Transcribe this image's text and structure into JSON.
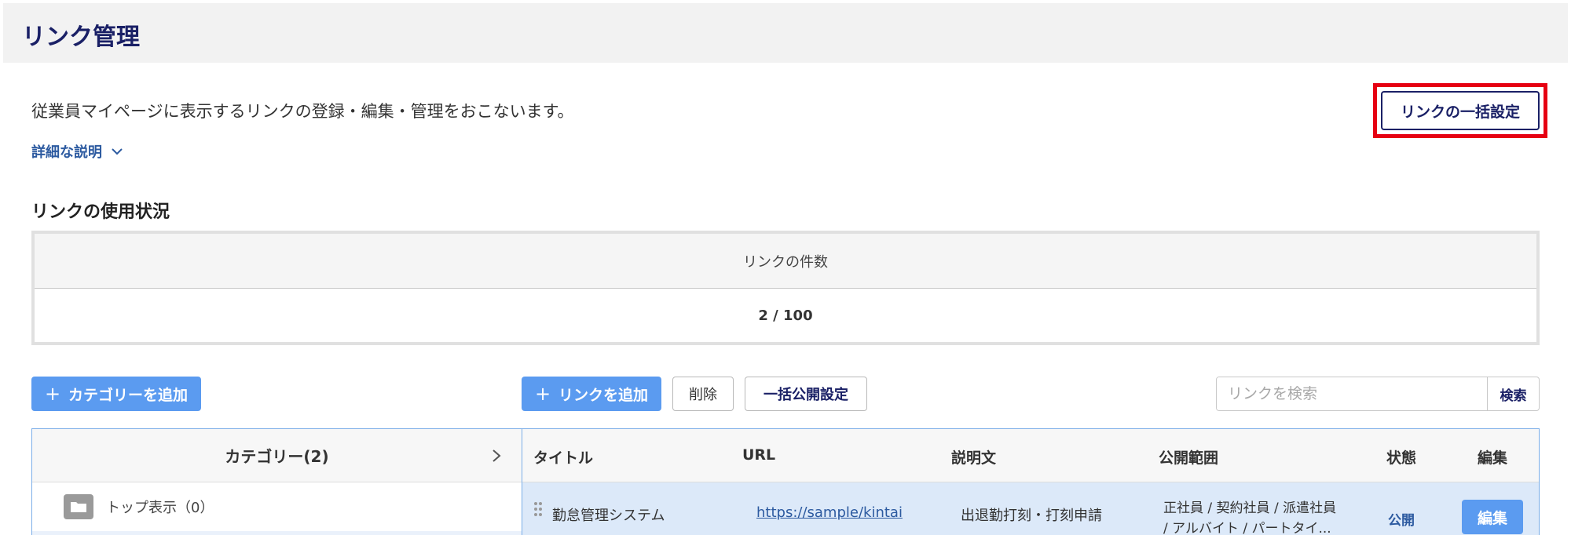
{
  "header": {
    "title": "リンク管理"
  },
  "intro": {
    "description": "従業員マイページに表示するリンクの登録・編集・管理をおこないます。",
    "detail_link": "詳細な説明",
    "bulk_settings_label": "リンクの一括設定"
  },
  "usage": {
    "title": "リンクの使用状況",
    "header_label": "リンクの件数",
    "count_value": "2 / 100"
  },
  "toolbar": {
    "add_category_label": "カテゴリーを追加",
    "add_link_label": "リンクを追加",
    "delete_label": "削除",
    "bulk_publish_label": "一括公開設定",
    "search_placeholder": "リンクを検索",
    "search_button_label": "検索"
  },
  "category_panel": {
    "header": "カテゴリー(2)",
    "items": [
      {
        "label": "トップ表示（0）"
      }
    ]
  },
  "link_table": {
    "columns": {
      "title": "タイトル",
      "url": "URL",
      "description": "説明文",
      "scope": "公開範囲",
      "status": "状態",
      "edit": "編集"
    },
    "rows": [
      {
        "title": "勤怠管理システム",
        "url": "https://sample/kintai",
        "description": "出退勤打刻・打刻申請",
        "scope_line1": "正社員 / 契約社員 / 派遣社員",
        "scope_line2": "/ アルバイト / パートタイ...",
        "status": "公開",
        "edit_label": "編集"
      }
    ]
  },
  "colors": {
    "title_navy": "#1a2066",
    "primary_blue": "#5b9bf0",
    "link_blue": "#2c5aa0",
    "highlight_red": "#e60012",
    "row_highlight": "#dce9f9"
  },
  "icons": [
    "chevron-down-icon",
    "plus-icon",
    "chevron-right-icon",
    "folder-icon",
    "drag-handle-icon"
  ]
}
